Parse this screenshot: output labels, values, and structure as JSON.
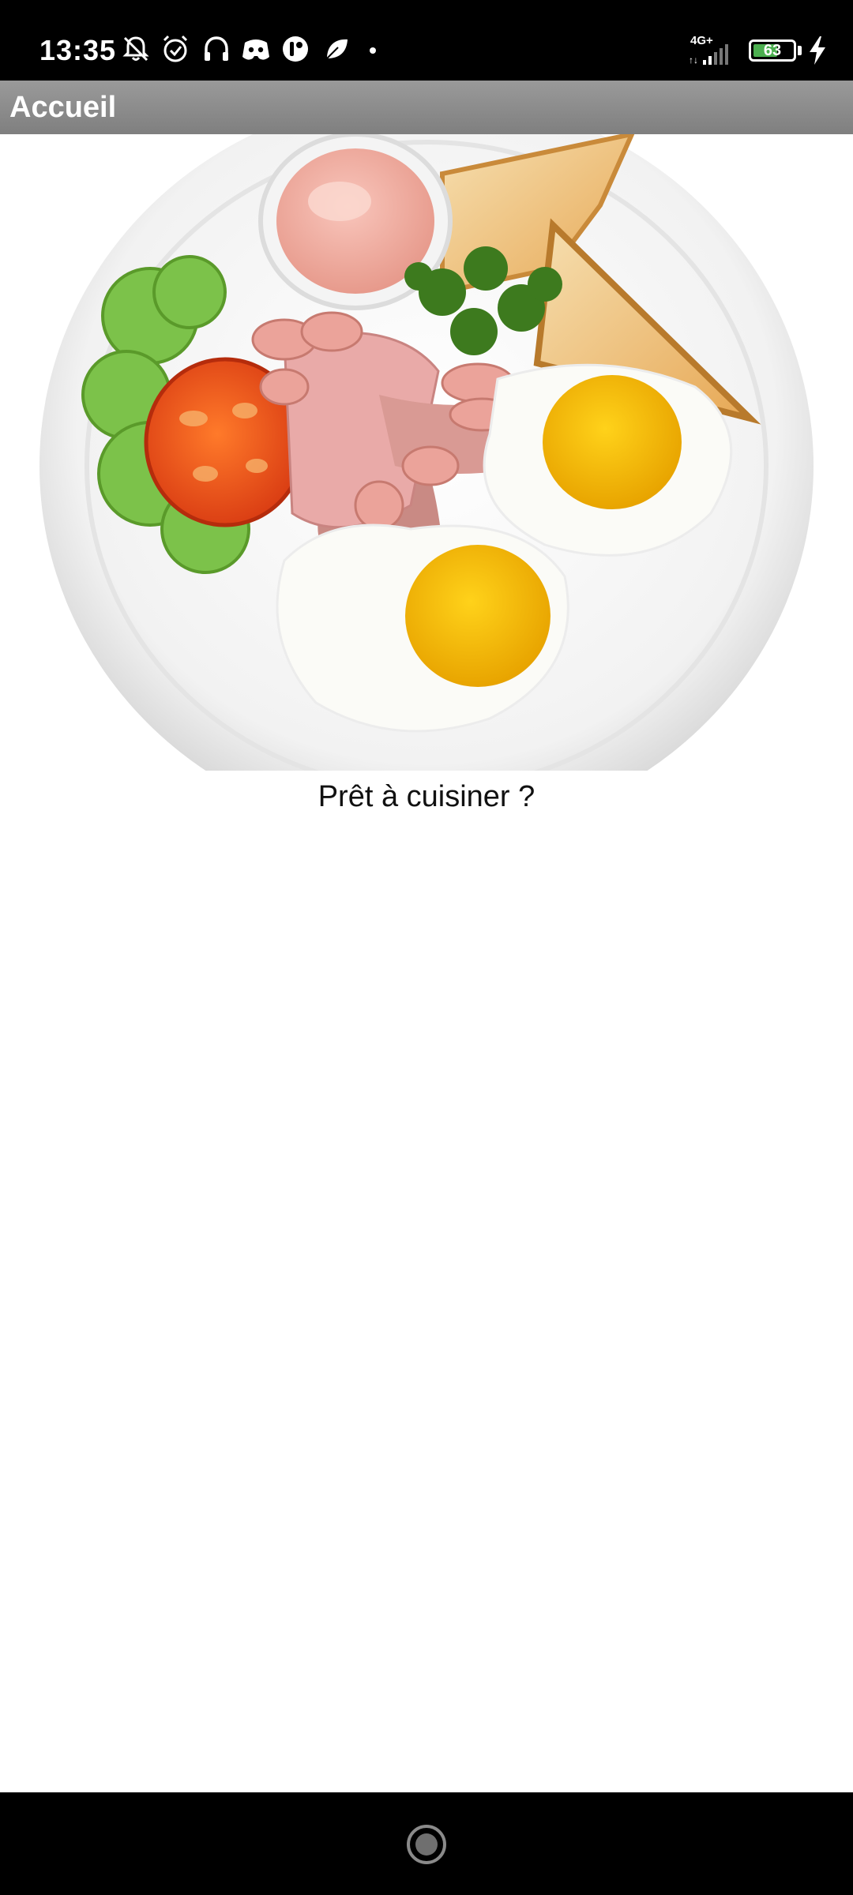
{
  "status_bar": {
    "time": "13:35",
    "network": "4G+",
    "battery_percent": "63",
    "battery_level": 0.63,
    "icons": [
      "bell-off-icon",
      "alarm-icon",
      "headphones-icon",
      "discord-icon",
      "app-icon",
      "leaf-icon",
      "dot-icon",
      "signal-icon",
      "charging-icon"
    ]
  },
  "app_bar": {
    "title": "Accueil"
  },
  "hero": {
    "caption": "Prêt à cuisiner ?",
    "image_name": "breakfast-plate"
  },
  "colors": {
    "app_bar": "#8c8c8c",
    "status_bar": "#000000",
    "battery_fill": "#4caf50"
  }
}
